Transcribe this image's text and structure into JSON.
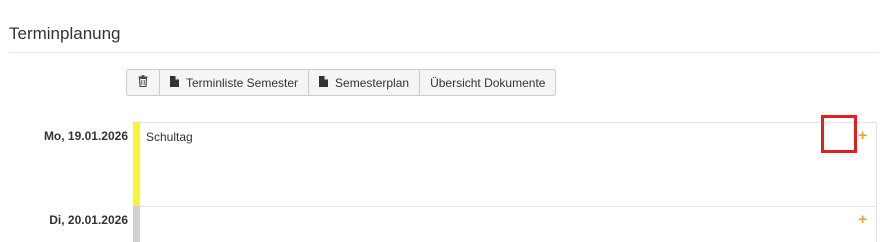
{
  "page": {
    "title": "Terminplanung"
  },
  "toolbar": {
    "trash_icon": "trash-icon",
    "buttons": [
      {
        "label": "Terminliste Semester",
        "icon": "document-icon"
      },
      {
        "label": "Semesterplan",
        "icon": "document-icon"
      },
      {
        "label": "Übersicht Dokumente"
      }
    ]
  },
  "days": [
    {
      "date": "Mo, 19.01.2026",
      "color": "#f7f33a",
      "entry": "Schultag",
      "add_label": "+"
    },
    {
      "date": "Di, 20.01.2026",
      "color": "#d0d0d0",
      "entry": "",
      "add_label": "+"
    }
  ],
  "colors": {
    "add_accent": "#f0a030",
    "highlight": "#e0201f"
  }
}
